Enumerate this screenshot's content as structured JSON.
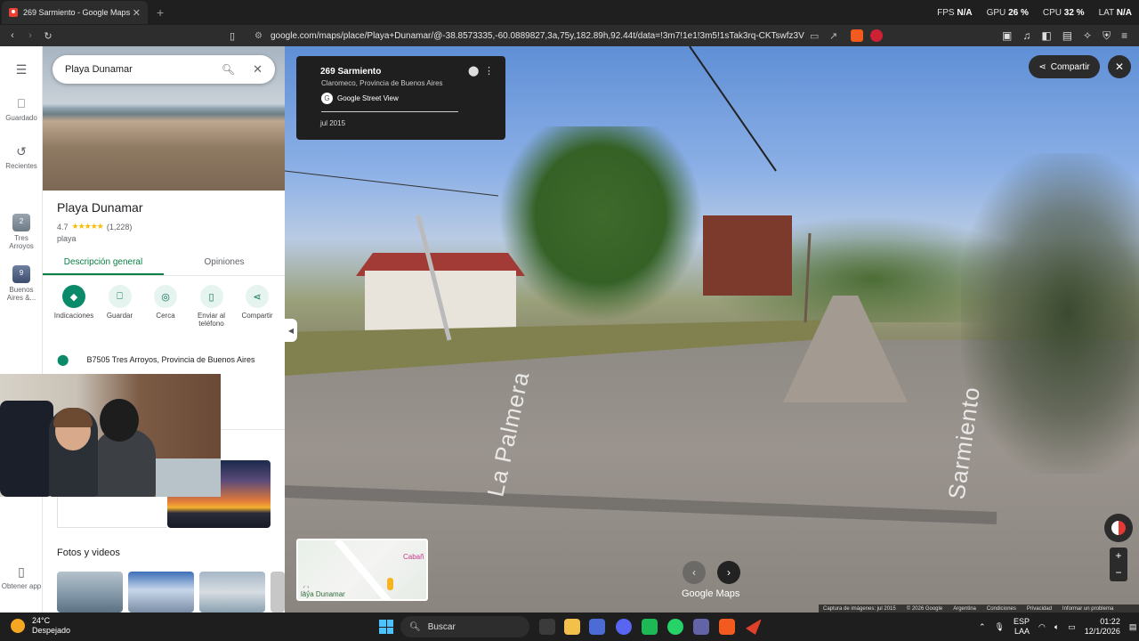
{
  "browser": {
    "tab_title": "269 Sarmiento - Google Maps",
    "url": "google.com/maps/place/Playa+Dunamar/@-38.8573335,-60.0889827,3a,75y,182.89h,92.44t/data=!3m7!1e1!3m5!1sTak3rq-CKTswfz3VZXtCMg!...",
    "perf": [
      {
        "label": "FPS",
        "value": "N/A"
      },
      {
        "label": "GPU",
        "value": "26 %"
      },
      {
        "label": "CPU",
        "value": "32 %"
      },
      {
        "label": "LAT",
        "value": "N/A"
      }
    ]
  },
  "rail": {
    "saved": "Guardado",
    "recent": "Recientes",
    "item1_label": "Tres Arroyos",
    "item1_count": "2",
    "item2_label": "Buenos Aires &...",
    "item2_count": "9",
    "get_app": "Obtener app"
  },
  "search": {
    "value": "Playa Dunamar"
  },
  "place": {
    "name": "Playa Dunamar",
    "rating": "4.7",
    "stars": "★★★★★",
    "reviews": "(1,228)",
    "type": "playa",
    "tabs": [
      "Descripción general",
      "Opiniones"
    ],
    "actions": [
      "Indicaciones",
      "Guardar",
      "Cerca",
      "Enviar al teléfono",
      "Compartir"
    ],
    "address": "B7505 Tres Arroyos, Provincia de Buenos Aires",
    "photos_title": "Fotos y videos"
  },
  "streetview": {
    "title": "269 Sarmiento",
    "subtitle": "Claromeco, Provincia de Buenos Aires",
    "source": "Google Street View",
    "date": "jul 2015",
    "share": "Compartir",
    "street_label_1": "La Palmera",
    "street_label_2": "Sarmiento",
    "logo": "Google Maps",
    "minimap_text1": "Cabañ",
    "minimap_text2": "laya Dunamar",
    "attribution": [
      "Captura de imágenes: jul 2015",
      "© 2026 Google",
      "Argentina",
      "Condiciones",
      "Privacidad",
      "Informar un problema"
    ]
  },
  "taskbar": {
    "temp": "24°C",
    "weather": "Despejado",
    "search_placeholder": "Buscar",
    "lang1": "ESP",
    "lang2": "LAA",
    "time": "01:22",
    "date": "12/1/2026"
  },
  "colors": {
    "accent": "#0b8043",
    "brave": "#f25a1e"
  }
}
